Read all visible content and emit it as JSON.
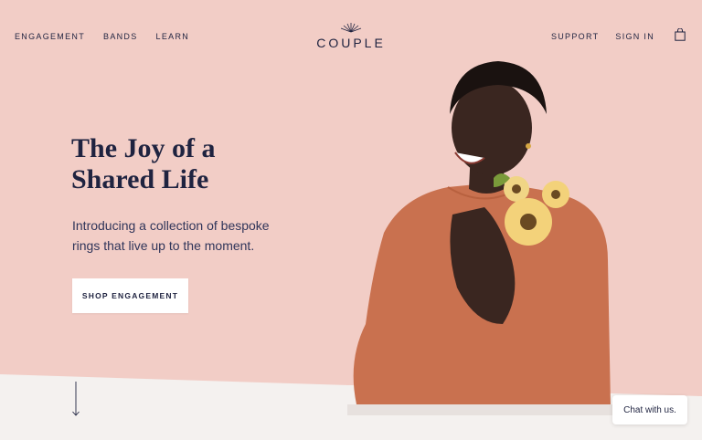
{
  "nav": {
    "left": [
      "ENGAGEMENT",
      "BANDS",
      "LEARN"
    ],
    "right": [
      "SUPPORT",
      "SIGN IN"
    ]
  },
  "logo": {
    "text": "COUPLE"
  },
  "hero": {
    "title_line1": "The Joy of a",
    "title_line2": "Shared Life",
    "subtitle_line1": "Introducing a collection of bespoke",
    "subtitle_line2": "rings that live up to the moment.",
    "cta": "SHOP ENGAGEMENT"
  },
  "chat": {
    "label": "Chat with us."
  },
  "icons": [
    "logo-sunburst-icon",
    "shopping-bag-icon",
    "scroll-down-arrow-icon"
  ],
  "colors": {
    "background": "#f2cdc6",
    "text": "#1f2340",
    "floor": "#f4f1ef",
    "dress": "#c9714f",
    "flower": "#f3d27a"
  }
}
